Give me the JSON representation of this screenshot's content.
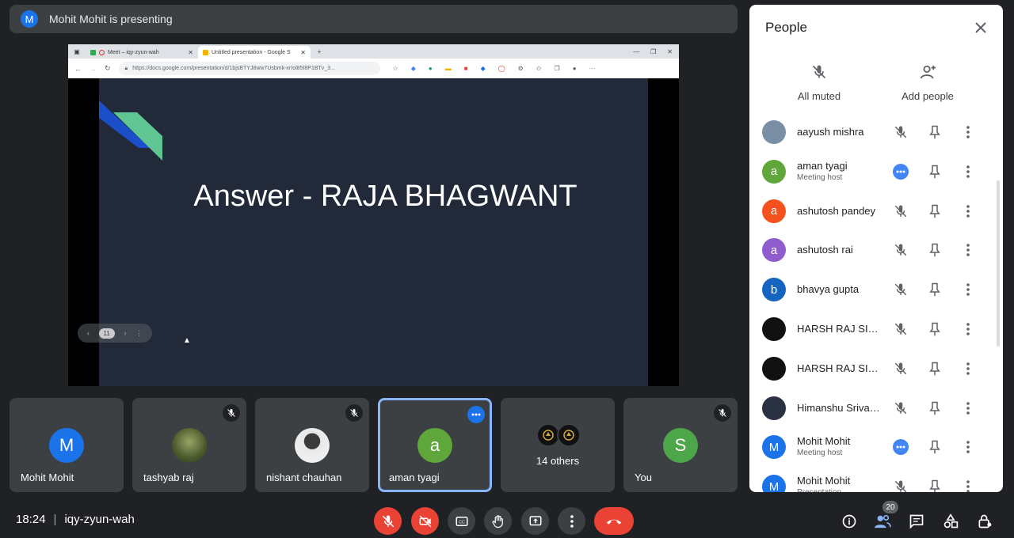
{
  "banner": {
    "avatar_letter": "M",
    "text": "Mohit Mohit is presenting"
  },
  "shared_screen": {
    "tabs": [
      {
        "label": "Meet – iqy-zyun-wah"
      },
      {
        "label": "Untitled presentation - Google S"
      }
    ],
    "url": "https://docs.google.com/presentation/d/1bjsBTYJ8ww7Usbmk-xrIol85I8P1BTv_3...",
    "slide_title": "Answer - RAJA BHAGWANT",
    "slide_page": "11"
  },
  "tiles": [
    {
      "name": "Mohit Mohit",
      "avatar": "M",
      "color": "#1a73e8"
    },
    {
      "name": "tashyab raj"
    },
    {
      "name": "nishant chauhan"
    },
    {
      "name": "aman tyagi",
      "avatar": "a",
      "color": "#5fa73b"
    },
    {
      "others_label": "14 others"
    },
    {
      "name": "You",
      "avatar": "S",
      "color": "#4ea64a"
    }
  ],
  "meeting": {
    "time": "18:24",
    "separator": "|",
    "code": "iqy-zyun-wah"
  },
  "controls": {
    "participants_count": "20"
  },
  "people": {
    "title": "People",
    "all_muted_label": "All muted",
    "add_people_label": "Add people",
    "list": [
      {
        "name": "aayush mishra",
        "color": "#7a8fa6"
      },
      {
        "name": "aman tyagi",
        "sub": "Meeting host",
        "avatar": "a",
        "color": "#5fa73b"
      },
      {
        "name": "ashutosh pandey",
        "avatar": "a",
        "color": "#f4511e"
      },
      {
        "name": "ashutosh rai",
        "avatar": "a",
        "color": "#8e5ccc"
      },
      {
        "name": "bhavya gupta",
        "avatar": "b",
        "color": "#1565c0"
      },
      {
        "name": "HARSH RAJ SINGH",
        "color": "#111111"
      },
      {
        "name": "HARSH RAJ SINGH",
        "color": "#111111"
      },
      {
        "name": "Himanshu Srivastava",
        "color": "#2a3140"
      },
      {
        "name": "Mohit Mohit",
        "sub": "Meeting host",
        "avatar": "M",
        "color": "#1a73e8"
      },
      {
        "name": "Mohit Mohit",
        "sub": "Presentation",
        "avatar": "M",
        "color": "#1a73e8"
      }
    ]
  }
}
